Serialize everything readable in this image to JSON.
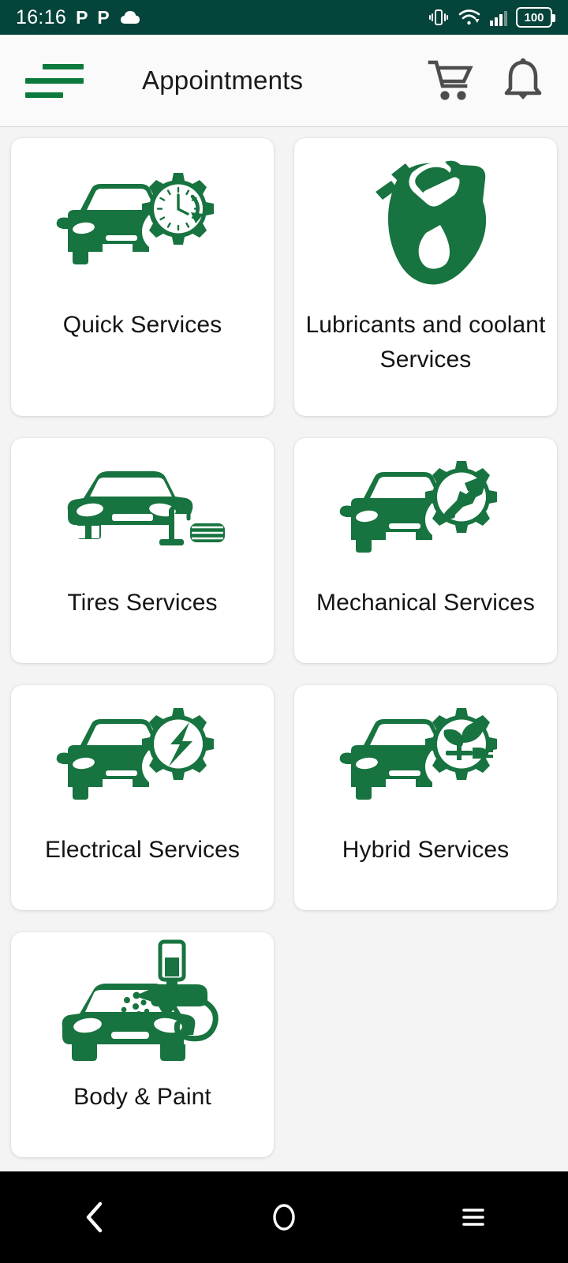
{
  "status_bar": {
    "time": "16:16",
    "app_glyph_1": "P",
    "app_glyph_2": "P",
    "cloud_icon": "cloud-icon",
    "vibrate_icon": "vibrate-icon",
    "wifi_icon": "wifi-icon",
    "signal_icon": "cellular-signal-icon",
    "battery_level": "100",
    "background_color": "#05443a",
    "foreground_color": "#ffffff"
  },
  "app_bar": {
    "menu_icon": "hamburger-menu-icon",
    "title": "Appointments",
    "cart_icon": "shopping-cart-icon",
    "notification_icon": "bell-icon",
    "background_color": "#fafafa",
    "menu_color": "#0c7a3d",
    "icon_color": "#4d4d4d"
  },
  "theme": {
    "brand_green": "#17733f",
    "page_background": "#f4f4f4",
    "card_background": "#ffffff",
    "text_color": "#141414"
  },
  "services": [
    {
      "id": "quick-services",
      "label": "Quick Services",
      "icon": "car-gear-clock-icon",
      "size": "tall"
    },
    {
      "id": "lubricants-services",
      "label": "Lubricants and coolant Services",
      "icon": "hand-oil-bottle-icon",
      "size": "tall"
    },
    {
      "id": "tires-services",
      "label": "Tires Services",
      "icon": "car-jack-tire-icon",
      "size": "short"
    },
    {
      "id": "mechanical-services",
      "label": "Mechanical Services",
      "icon": "car-gear-wrench-icon",
      "size": "short"
    },
    {
      "id": "electrical-services",
      "label": "Electrical Services",
      "icon": "car-gear-bolt-icon",
      "size": "short"
    },
    {
      "id": "hybrid-services",
      "label": "Hybrid Services",
      "icon": "car-gear-leaf-plug-icon",
      "size": "short"
    },
    {
      "id": "body-paint-services",
      "label": "Body & Paint",
      "icon": "car-spray-gun-icon",
      "size": "short"
    }
  ],
  "nav_bar": {
    "back_label": "back-icon",
    "home_label": "home-icon",
    "recents_label": "recents-icon",
    "background_color": "#000000"
  }
}
